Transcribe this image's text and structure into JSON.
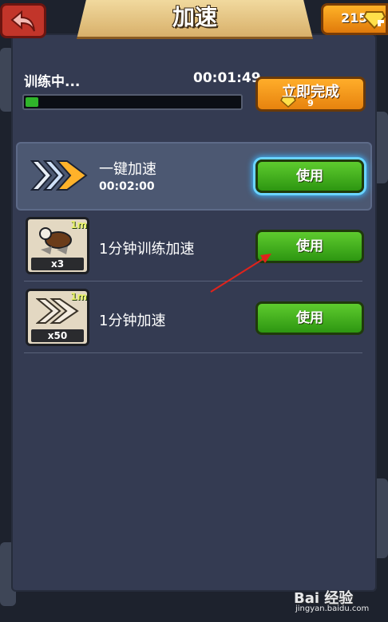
{
  "header": {
    "title": "加速",
    "gems": "215"
  },
  "training": {
    "label": "训练中...",
    "time": "00:01:49",
    "progress": 0.06,
    "finish_label": "立即完成",
    "finish_cost": "9"
  },
  "items": [
    {
      "name": "一键加速",
      "sub": "00:02:00",
      "count": "",
      "badge": "",
      "button": "使用"
    },
    {
      "name": "1分钟训练加速",
      "sub": "",
      "count": "x3",
      "badge": "1m",
      "button": "使用"
    },
    {
      "name": "1分钟加速",
      "sub": "",
      "count": "x50",
      "badge": "1m",
      "button": "使用"
    }
  ],
  "watermark": {
    "text": "Bai 经验",
    "sub": "jingyan.baidu.com"
  },
  "colors": {
    "accent_green": "#2d9611",
    "accent_orange": "#e7830e",
    "panel": "#343b52"
  }
}
